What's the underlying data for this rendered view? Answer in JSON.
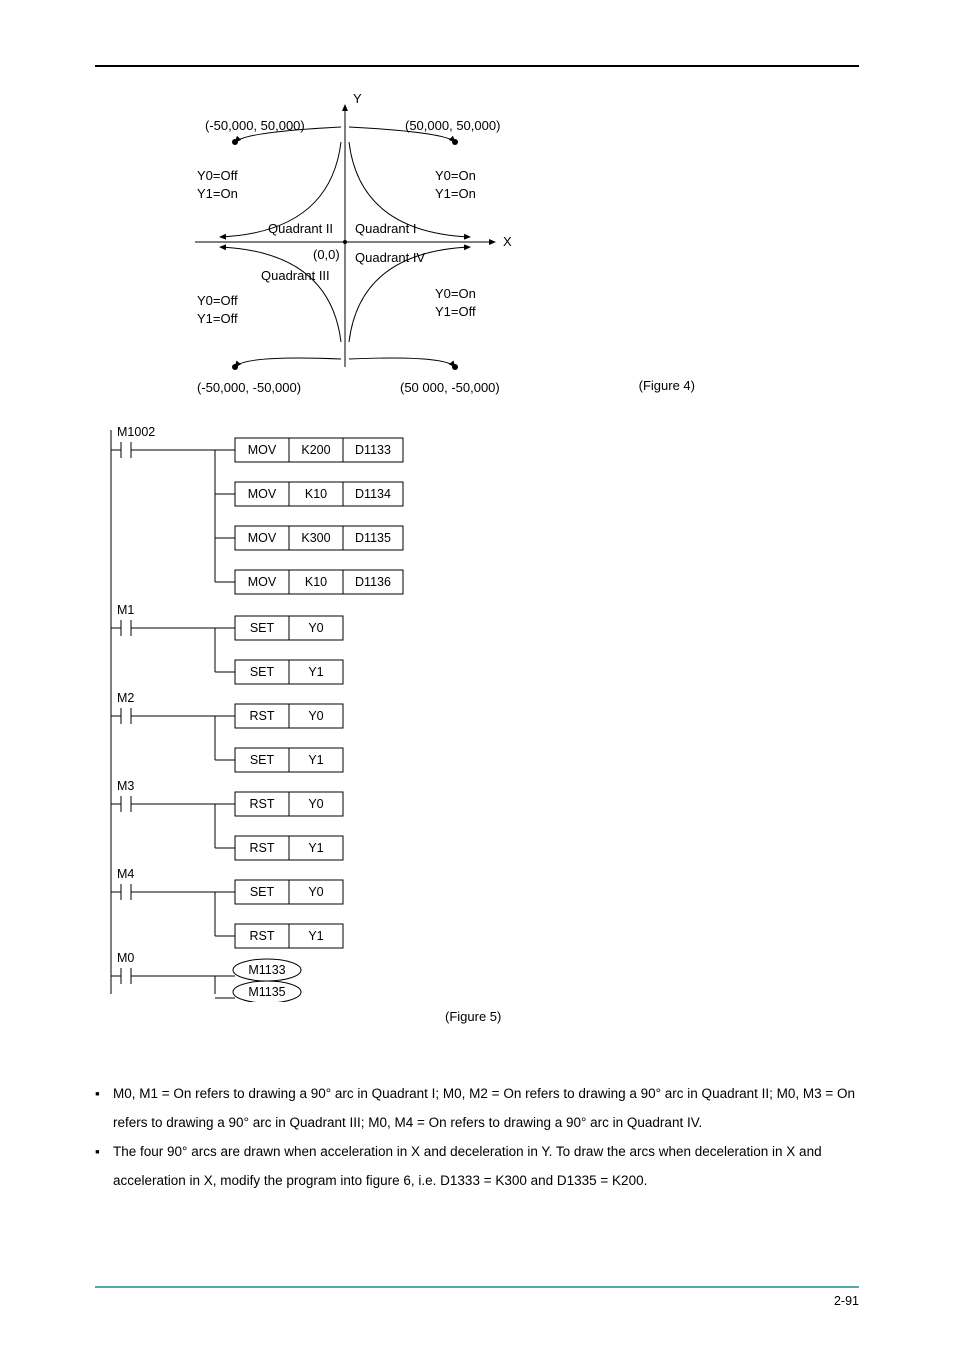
{
  "fig4": {
    "axis_y": "Y",
    "axis_x": "X",
    "origin": "(0,0)",
    "top_left_coord": "(-50,000,  50,000)",
    "top_right_coord": "(50,000,  50,000)",
    "bot_left_coord": "(-50,000,  -50,000)",
    "bot_right_coord": "(50 000,  -50,000)",
    "q1_label": "Quadrant I",
    "q2_label": "Quadrant II",
    "q3_label": "Quadrant III",
    "q4_label": "Quadrant IV",
    "q1_y0": "Y0=On",
    "q1_y1": "Y1=On",
    "q2_y0": "Y0=Off",
    "q2_y1": "Y1=On",
    "q3_y0": "Y0=Off",
    "q3_y1": "Y1=Off",
    "q4_y0": "Y0=On",
    "q4_y1": "Y1=Off",
    "caption": "(Figure 4)"
  },
  "ladder": {
    "r1": {
      "contact": "M1002",
      "ops": [
        {
          "op": "MOV",
          "src": "K200",
          "dst": "D1133"
        },
        {
          "op": "MOV",
          "src": "K10",
          "dst": "D1134"
        },
        {
          "op": "MOV",
          "src": "K300",
          "dst": "D1135"
        },
        {
          "op": "MOV",
          "src": "K10",
          "dst": "D1136"
        }
      ]
    },
    "r2": {
      "contact": "M1",
      "ops": [
        {
          "op": "SET",
          "src": "Y0"
        },
        {
          "op": "SET",
          "src": "Y1"
        }
      ]
    },
    "r3": {
      "contact": "M2",
      "ops": [
        {
          "op": "RST",
          "src": "Y0"
        },
        {
          "op": "SET",
          "src": "Y1"
        }
      ]
    },
    "r4": {
      "contact": "M3",
      "ops": [
        {
          "op": "RST",
          "src": "Y0"
        },
        {
          "op": "RST",
          "src": "Y1"
        }
      ]
    },
    "r5": {
      "contact": "M4",
      "ops": [
        {
          "op": "SET",
          "src": "Y0"
        },
        {
          "op": "RST",
          "src": "Y1"
        }
      ]
    },
    "r6": {
      "contact": "M0",
      "coils": [
        "M1133",
        "M1135"
      ]
    }
  },
  "fig5_caption": "(Figure 5)",
  "body": {
    "b1": "M0, M1 = On refers to drawing a 90° arc in Quadrant I; M0, M2 = On refers to drawing a 90° arc in Quadrant II; M0, M3 = On refers to drawing a 90° arc in Quadrant III; M0, M4 = On refers to drawing a 90° arc in Quadrant IV.",
    "b2": "The four 90° arcs are drawn when acceleration in X and deceleration in Y. To draw the arcs when deceleration in X and acceleration in X, modify the program into figure 6, i.e. D1333 = K300 and D1335 = K200."
  },
  "page_number": "2-91",
  "chart_data": {
    "type": "table",
    "description": "PLC ladder program instructions (Figure 5)",
    "rungs": [
      {
        "condition": "M1002",
        "instructions": [
          [
            "MOV",
            "K200",
            "D1133"
          ],
          [
            "MOV",
            "K10",
            "D1134"
          ],
          [
            "MOV",
            "K300",
            "D1135"
          ],
          [
            "MOV",
            "K10",
            "D1136"
          ]
        ]
      },
      {
        "condition": "M1",
        "instructions": [
          [
            "SET",
            "Y0"
          ],
          [
            "SET",
            "Y1"
          ]
        ]
      },
      {
        "condition": "M2",
        "instructions": [
          [
            "RST",
            "Y0"
          ],
          [
            "SET",
            "Y1"
          ]
        ]
      },
      {
        "condition": "M3",
        "instructions": [
          [
            "RST",
            "Y0"
          ],
          [
            "RST",
            "Y1"
          ]
        ]
      },
      {
        "condition": "M4",
        "instructions": [
          [
            "SET",
            "Y0"
          ],
          [
            "RST",
            "Y1"
          ]
        ]
      },
      {
        "condition": "M0",
        "instructions": [
          [
            "COIL",
            "M1133"
          ],
          [
            "COIL",
            "M1135"
          ]
        ]
      }
    ],
    "quadrant_diagram": {
      "points": [
        {
          "label": "(-50,000, 50,000)",
          "y0": "Off",
          "y1": "On",
          "quadrant": "II"
        },
        {
          "label": "(50,000, 50,000)",
          "y0": "On",
          "y1": "On",
          "quadrant": "I"
        },
        {
          "label": "(-50,000, -50,000)",
          "y0": "Off",
          "y1": "Off",
          "quadrant": "III"
        },
        {
          "label": "(50,000, -50,000)",
          "y0": "On",
          "y1": "Off",
          "quadrant": "IV"
        }
      ]
    }
  }
}
